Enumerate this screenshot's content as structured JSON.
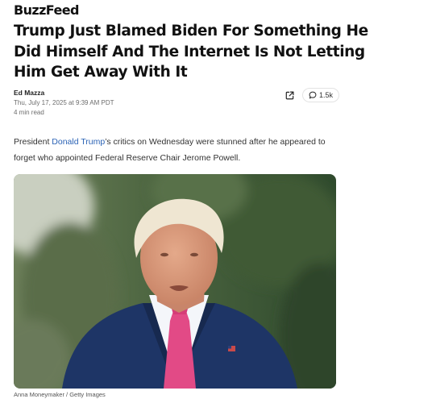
{
  "site": {
    "logo": "BuzzFeed"
  },
  "article": {
    "headline": "Trump Just Blamed Biden For Something He Did Himself And The Internet Is Not Letting Him Get Away With It",
    "author": "Ed Mazza",
    "date": "Thu, July 17, 2025 at 9:39 AM PDT",
    "read_time": "4 min read",
    "lede_before": "President ",
    "lede_link": "Donald Trump",
    "lede_after": "’s critics on Wednesday were stunned after he appeared to forget who appointed Federal Reserve Chair Jerome Powell.",
    "image_credit": "Anna Moneymaker / Getty Images"
  },
  "actions": {
    "comment_count": "1.5k"
  },
  "icons": {
    "share": "share-external-icon",
    "comment": "comment-bubble-icon"
  },
  "colors": {
    "link": "#2a62b5",
    "suit": "#1e3566",
    "tie": "#e24a86"
  }
}
